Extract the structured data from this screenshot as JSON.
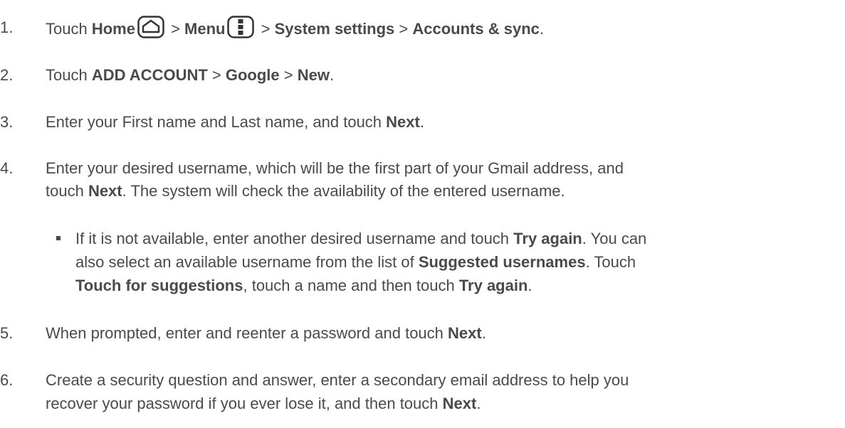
{
  "steps": [
    {
      "number": "1.",
      "parts": [
        "Touch ",
        "Home",
        " > ",
        "Menu",
        " > ",
        "System settings",
        " > ",
        "Accounts & sync",
        "."
      ]
    },
    {
      "number": "2.",
      "parts": [
        "Touch ",
        "ADD ACCOUNT",
        " > ",
        "Google",
        " > ",
        "New",
        "."
      ]
    },
    {
      "number": "3.",
      "parts": [
        "Enter your First name and Last name, and touch ",
        "Next",
        "."
      ]
    },
    {
      "number": "4.",
      "line1": "Enter your desired username, which will be the first part of your Gmail address, and",
      "line2_parts": [
        "touch ",
        "Next",
        ". The system will check the availability of the entered username."
      ]
    },
    {
      "number": "5.",
      "parts": [
        "When prompted, enter and reenter a password and touch ",
        "Next",
        "."
      ]
    },
    {
      "number": "6.",
      "line1": "Create a security question and answer, enter a secondary email address to help you",
      "line2_parts": [
        "recover your password if you ever lose it, and then touch ",
        "Next",
        "."
      ]
    }
  ],
  "sub_bullet": {
    "line1_parts": [
      "If it is not available, enter another desired username and touch ",
      "Try again",
      ". You can"
    ],
    "line2_parts": [
      "also select an available username from the list of ",
      "Suggested usernames",
      ". Touch"
    ],
    "line3_parts": [
      "Touch for suggestions",
      ", touch a name and then touch ",
      "Try again",
      "."
    ]
  },
  "icons": {
    "home": "home-icon",
    "menu": "menu-icon"
  }
}
